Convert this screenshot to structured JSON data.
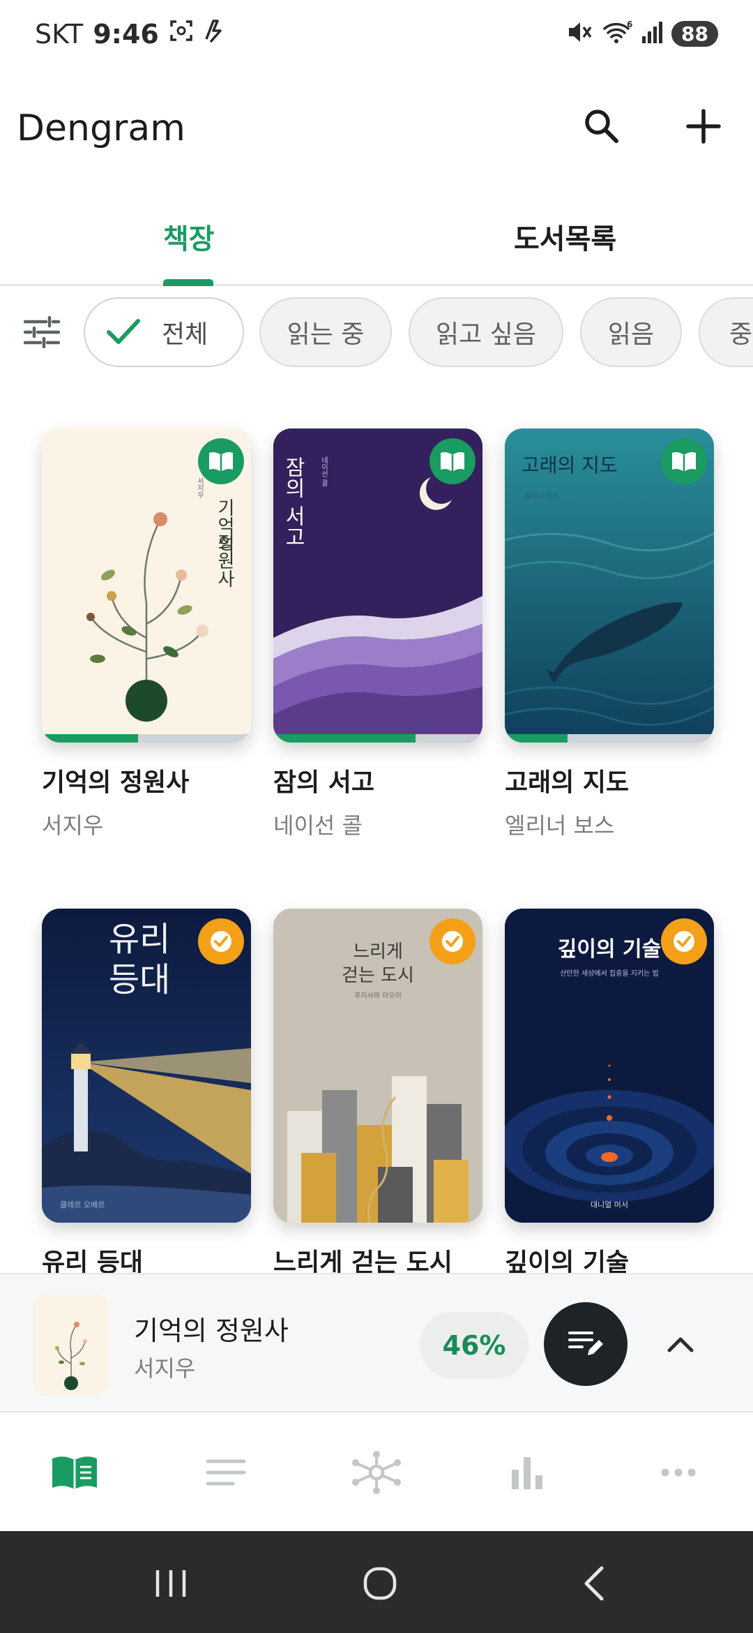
{
  "status_bar": {
    "carrier": "SKT",
    "time": "9:46",
    "battery": "88",
    "wifi_badge": "6",
    "left_icons": [
      "screenshot-icon",
      "bolt-icon"
    ],
    "right_icons": [
      "mute-icon",
      "wifi-icon",
      "signal-icon",
      "battery-icon"
    ]
  },
  "app_bar": {
    "title": "Dengram",
    "actions": [
      "search-icon",
      "plus-icon"
    ]
  },
  "tabs": [
    {
      "label": "책장",
      "active": true
    },
    {
      "label": "도서목록",
      "active": false
    }
  ],
  "filters": {
    "chips": [
      {
        "label": "전체",
        "selected": true
      },
      {
        "label": "읽는 중",
        "selected": false
      },
      {
        "label": "읽고 싶음",
        "selected": false
      },
      {
        "label": "읽음",
        "selected": false
      },
      {
        "label": "중단",
        "selected": false
      }
    ]
  },
  "books": [
    {
      "title": "기억의 정원사",
      "author": "서지우",
      "status": "reading",
      "progress": 0.46,
      "cover": {
        "title_lines": [
          "기억의",
          "정원사"
        ],
        "author": "서지우",
        "bg": "#fbf3e6"
      }
    },
    {
      "title": "잠의 서고",
      "author": "네이선 콜",
      "status": "reading",
      "progress": 0.68,
      "cover": {
        "title_lines": [
          "잠의",
          "서고"
        ],
        "author": "네이선 콜",
        "bg": "#3a2563"
      }
    },
    {
      "title": "고래의 지도",
      "author": "엘리너 보스",
      "status": "reading",
      "progress": 0.3,
      "cover": {
        "title_lines": [
          "고래의 지도"
        ],
        "author": "엘리너 보스",
        "bg": "#1f6f82"
      }
    },
    {
      "title": "유리 등대",
      "author": "",
      "status": "done",
      "progress": 1,
      "cover": {
        "title_lines": [
          "유리",
          "등대"
        ],
        "author": "클레르 오베르",
        "bg": "#0f1f45"
      }
    },
    {
      "title": "느리게 걷는 도시",
      "author": "",
      "status": "done",
      "progress": 1,
      "cover": {
        "title_lines": [
          "느리게",
          "걷는 도시"
        ],
        "author": "후지사와 아오이",
        "bg": "#c8c2b6"
      }
    },
    {
      "title": "깊이의 기술",
      "author": "",
      "status": "done",
      "progress": 1,
      "cover": {
        "title_lines": [
          "깊이의 기술"
        ],
        "subtitle": "산만한 세상에서 집중을 지키는 법",
        "author": "대니얼 머서",
        "bg": "#0c1a3f"
      }
    }
  ],
  "now_reading": {
    "title": "기억의 정원사",
    "author": "서지우",
    "percent": "46%",
    "actions": [
      "edit-note-icon",
      "chevron-up-icon"
    ]
  },
  "bottom_nav": {
    "items": [
      "library-icon",
      "list-icon",
      "graph-icon",
      "stats-icon",
      "more-icon"
    ],
    "active": "library-icon",
    "active_color": "#1a9b62"
  },
  "system_nav": [
    "recents-icon",
    "home-icon",
    "back-icon"
  ],
  "colors": {
    "accent": "#1a9b62",
    "done_badge": "#f4a019"
  }
}
